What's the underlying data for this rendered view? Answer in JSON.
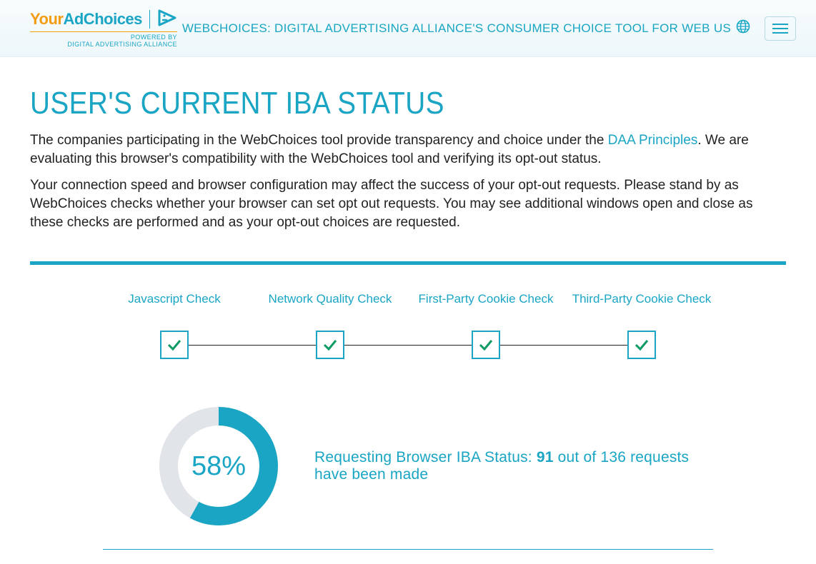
{
  "header": {
    "logo_your": "Your",
    "logo_ad": "AdChoices",
    "logo_powered": "POWERED BY",
    "logo_org": "DIGITAL ADVERTISING ALLIANCE",
    "title": "WEBCHOICES: DIGITAL ADVERTISING ALLIANCE'S CONSUMER CHOICE TOOL FOR WEB US"
  },
  "page": {
    "heading": "USER'S CURRENT IBA STATUS",
    "p1_a": "The companies participating in the WebChoices tool provide transparency and choice under the ",
    "p1_link": "DAA Principles",
    "p1_b": ". We are evaluating this browser's compatibility with the WebChoices tool and verifying its opt-out status.",
    "p2": "Your connection speed and browser configuration may affect the success of your opt-out requests. Please stand by as WebChoices checks whether your browser can set opt out requests. You may see additional windows open and close as these checks are performed and as your opt-out choices are requested."
  },
  "checks": {
    "items": [
      {
        "label": "Javascript Check"
      },
      {
        "label": "Network Quality Check"
      },
      {
        "label": "First-Party Cookie Check"
      },
      {
        "label": "Third-Party Cookie Check"
      }
    ]
  },
  "progress": {
    "percent": 58,
    "percent_label": "58%",
    "text_a": "Requesting Browser IBA Status: ",
    "count": "91",
    "text_b": " out of 136 requests have been made"
  },
  "colors": {
    "accent": "#1aa5c4",
    "orange": "#f39c12",
    "check_green": "#0f9b64",
    "donut_track": "#e1e4e8"
  }
}
